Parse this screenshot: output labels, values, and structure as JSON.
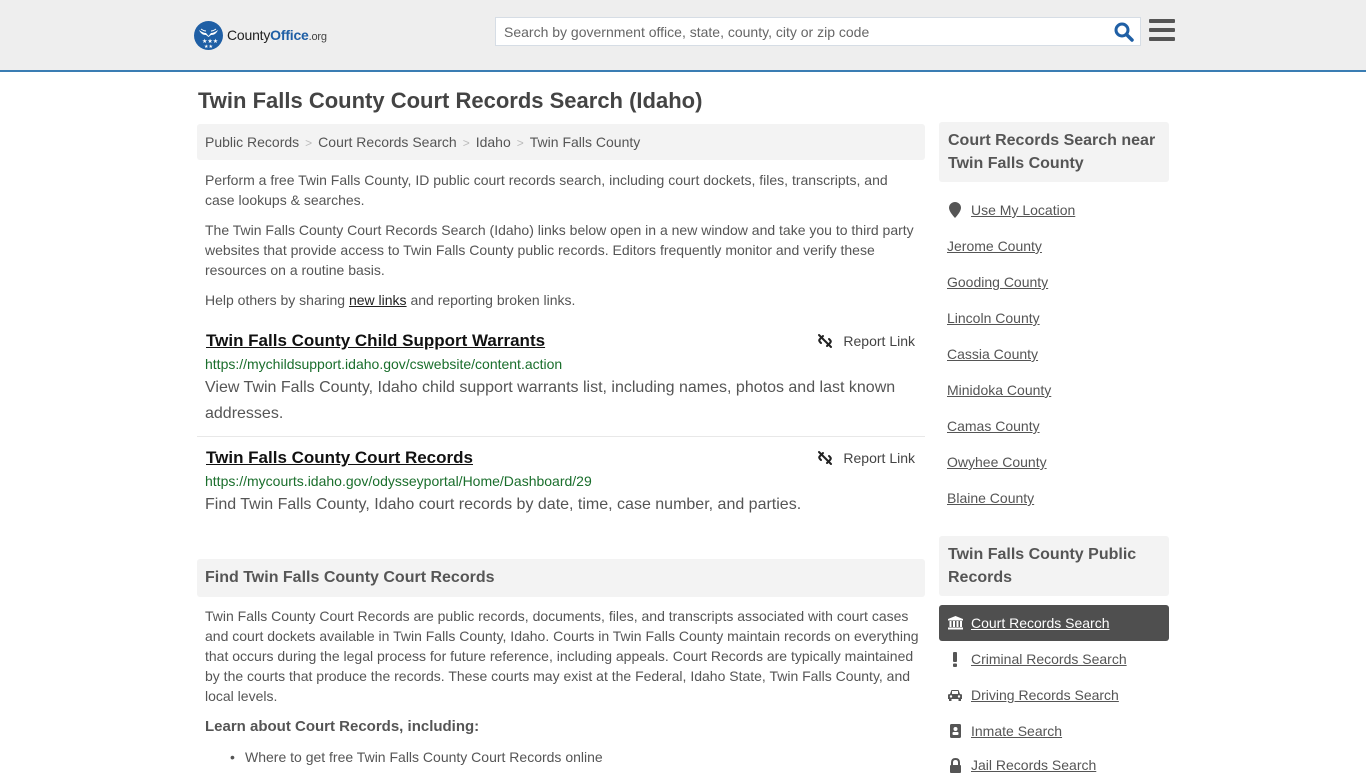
{
  "header": {
    "logo": {
      "county": "County",
      "office": "Office",
      "org": ".org"
    },
    "search": {
      "placeholder": "Search by government office, state, county, city or zip code",
      "value": ""
    },
    "icons": {
      "search": "search-icon",
      "menu": "hamburger-menu-icon"
    },
    "accent_color": "#3a7db3"
  },
  "page": {
    "title": "Twin Falls County Court Records Search (Idaho)",
    "breadcrumb": [
      "Public Records",
      "Court Records Search",
      "Idaho",
      "Twin Falls County"
    ],
    "intro": {
      "p1": "Perform a free Twin Falls County, ID public court records search, including court dockets, files, transcripts, and case lookups & searches.",
      "p2": "The Twin Falls County Court Records Search (Idaho) links below open in a new window and take you to third party websites that provide access to Twin Falls County public records. Editors frequently monitor and verify these resources on a routine basis.",
      "p3_before": "Help others by sharing ",
      "p3_link": "new links",
      "p3_after": " and reporting broken links."
    },
    "results": [
      {
        "title": "Twin Falls County Child Support Warrants",
        "url": "https://mychildsupport.idaho.gov/cswebsite/content.action",
        "description": "View Twin Falls County, Idaho child support warrants list, including names, photos and last known addresses.",
        "report_label": "Report Link"
      },
      {
        "title": "Twin Falls County Court Records",
        "url": "https://mycourts.idaho.gov/odysseyportal/Home/Dashboard/29",
        "description": "Find Twin Falls County, Idaho court records by date, time, case number, and parties.",
        "report_label": "Report Link"
      }
    ],
    "find_section": {
      "heading": "Find Twin Falls County Court Records",
      "body": "Twin Falls County Court Records are public records, documents, files, and transcripts associated with court cases and court dockets available in Twin Falls County, Idaho. Courts in Twin Falls County maintain records on everything that occurs during the legal process for future reference, including appeals. Court Records are typically maintained by the courts that produce the records. These courts may exist at the Federal, Idaho State, Twin Falls County, and local levels.",
      "learn_heading": "Learn about Court Records, including:",
      "learn_items": [
        "Where to get free Twin Falls County Court Records online"
      ]
    }
  },
  "sidebar": {
    "nearby": {
      "heading": "Court Records Search near Twin Falls County",
      "use_location": "Use My Location",
      "counties": [
        "Jerome County",
        "Gooding County",
        "Lincoln County",
        "Cassia County",
        "Minidoka County",
        "Camas County",
        "Owyhee County",
        "Blaine County"
      ]
    },
    "public_records": {
      "heading": "Twin Falls County Public Records",
      "items": [
        {
          "label": "Court Records Search",
          "icon": "courthouse-icon",
          "active": true
        },
        {
          "label": "Criminal Records Search",
          "icon": "exclamation-icon",
          "active": false
        },
        {
          "label": "Driving Records Search",
          "icon": "car-icon",
          "active": false
        },
        {
          "label": "Inmate Search",
          "icon": "id-badge-icon",
          "active": false
        },
        {
          "label": "Jail Records Search",
          "icon": "lock-icon",
          "active": false
        }
      ]
    }
  }
}
